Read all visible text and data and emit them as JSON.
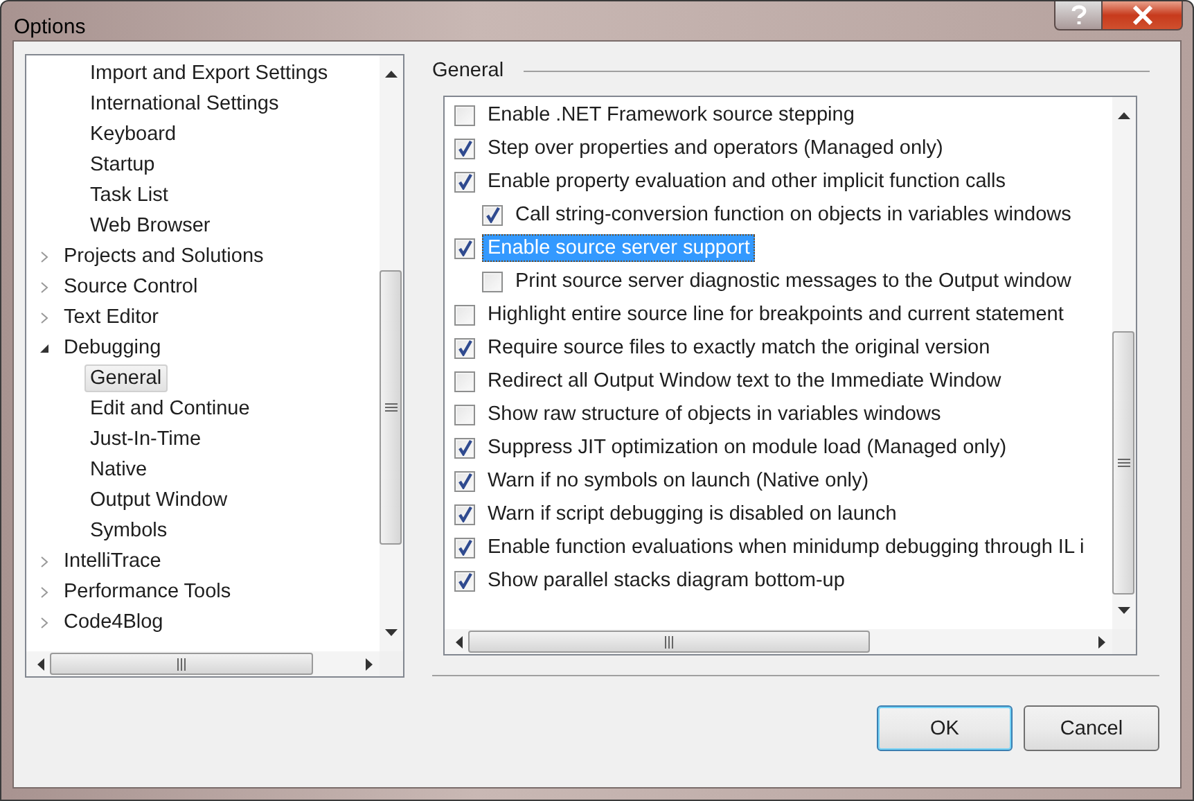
{
  "window": {
    "title": "Options"
  },
  "tree": {
    "items": [
      {
        "children": [
          {
            "label": "Import and Export Settings",
            "selected": false
          },
          {
            "label": "International Settings",
            "selected": false
          },
          {
            "label": "Keyboard",
            "selected": false
          },
          {
            "label": "Startup",
            "selected": false
          },
          {
            "label": "Task List",
            "selected": false
          },
          {
            "label": "Web Browser",
            "selected": false
          }
        ]
      },
      {
        "label": "Projects and Solutions",
        "selected": false,
        "expanded": false
      },
      {
        "label": "Source Control",
        "selected": false,
        "expanded": false
      },
      {
        "label": "Text Editor",
        "selected": false,
        "expanded": false
      },
      {
        "label": "Debugging",
        "selected": false,
        "expanded": true,
        "children": [
          {
            "label": "General",
            "selected": true
          },
          {
            "label": "Edit and Continue",
            "selected": false
          },
          {
            "label": "Just-In-Time",
            "selected": false
          },
          {
            "label": "Native",
            "selected": false
          },
          {
            "label": "Output Window",
            "selected": false
          },
          {
            "label": "Symbols",
            "selected": false
          }
        ]
      },
      {
        "label": "IntelliTrace",
        "selected": false,
        "expanded": false
      },
      {
        "label": "Performance Tools",
        "selected": false,
        "expanded": false
      },
      {
        "label": "Code4Blog",
        "selected": false,
        "expanded": false
      }
    ]
  },
  "page": {
    "heading": "General",
    "options": [
      {
        "label": "Enable .NET Framework source stepping",
        "checked": false,
        "selected": false
      },
      {
        "label": "Step over properties and operators (Managed only)",
        "checked": true,
        "selected": false
      },
      {
        "label": "Enable property evaluation and other implicit function calls",
        "checked": true,
        "selected": false,
        "children": [
          {
            "label": "Call string-conversion function on objects in variables windows",
            "checked": true,
            "selected": false
          }
        ]
      },
      {
        "label": "Enable source server support",
        "checked": true,
        "selected": true,
        "children": [
          {
            "label": "Print source server diagnostic messages to the Output window",
            "checked": false,
            "selected": false
          }
        ]
      },
      {
        "label": "Highlight entire source line for breakpoints and current statement",
        "checked": false,
        "selected": false
      },
      {
        "label": "Require source files to exactly match the original version",
        "checked": true,
        "selected": false
      },
      {
        "label": "Redirect all Output Window text to the Immediate Window",
        "checked": false,
        "selected": false
      },
      {
        "label": "Show raw structure of objects in variables windows",
        "checked": false,
        "selected": false
      },
      {
        "label": "Suppress JIT optimization on module load (Managed only)",
        "checked": true,
        "selected": false
      },
      {
        "label": "Warn if no symbols on launch (Native only)",
        "checked": true,
        "selected": false
      },
      {
        "label": "Warn if script debugging is disabled on launch",
        "checked": true,
        "selected": false
      },
      {
        "label": "Enable function evaluations when minidump debugging through IL i",
        "checked": true,
        "selected": false
      },
      {
        "label": "Show parallel stacks diagram bottom-up",
        "checked": true,
        "selected": false
      }
    ]
  },
  "buttons": [
    {
      "label": "OK",
      "kind": "default"
    },
    {
      "label": "Cancel",
      "kind": "normal"
    }
  ]
}
